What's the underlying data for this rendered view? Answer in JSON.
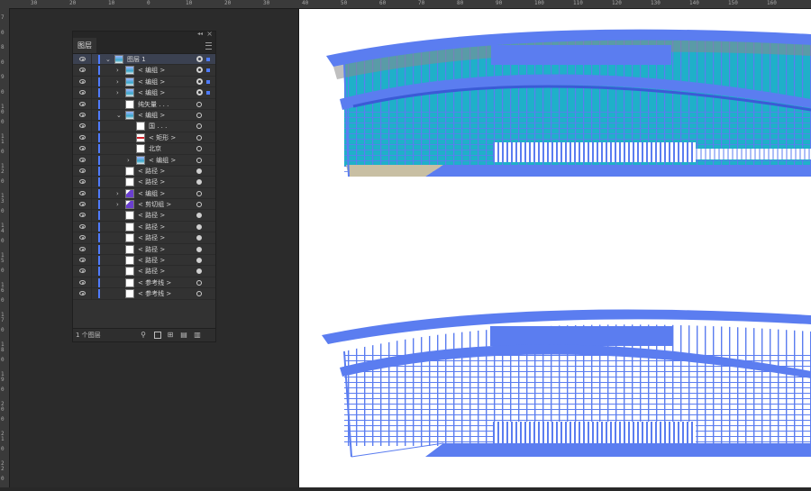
{
  "ruler": {
    "top_labels": [
      "30",
      "20",
      "10",
      "0",
      "10",
      "20",
      "30",
      "40",
      "50",
      "60",
      "70",
      "80",
      "90",
      "100",
      "110",
      "120",
      "130",
      "140",
      "150",
      "160"
    ],
    "left_labels": [
      "7",
      "0",
      "8",
      "0",
      "9",
      "0",
      "10",
      "0",
      "11",
      "0",
      "12",
      "0",
      "13",
      "0",
      "14",
      "0",
      "15",
      "0",
      "16",
      "0",
      "17",
      "0",
      "18",
      "0",
      "19",
      "0",
      "20",
      "0",
      "21",
      "0",
      "22",
      "0"
    ]
  },
  "panel": {
    "tab_label": "图层",
    "footer_count": "1 个图层",
    "layers": [
      {
        "label": "图层 1",
        "chev": "v",
        "thumb": "building",
        "target": "ring",
        "sel": "square",
        "top": true,
        "indent": 0
      },
      {
        "label": "< 编组 >",
        "chev": ">",
        "thumb": "building",
        "target": "ring",
        "sel": "square",
        "indent": 1
      },
      {
        "label": "< 编组 >",
        "chev": ">",
        "thumb": "building",
        "target": "ring",
        "sel": "square",
        "indent": 1
      },
      {
        "label": "< 编组 >",
        "chev": ">",
        "thumb": "building",
        "target": "ring",
        "sel": "square",
        "indent": 1
      },
      {
        "label": "纯矢量 . . .",
        "chev": "",
        "thumb": "white",
        "target": "",
        "sel": "",
        "indent": 1
      },
      {
        "label": "< 编组 >",
        "chev": "v",
        "thumb": "building",
        "target": "",
        "sel": "",
        "indent": 1
      },
      {
        "label": "国 . . .",
        "chev": "",
        "thumb": "white",
        "target": "",
        "sel": "",
        "indent": 2
      },
      {
        "label": "< 矩形 >",
        "chev": "",
        "thumb": "rect",
        "target": "",
        "sel": "",
        "indent": 2
      },
      {
        "label": "北京",
        "chev": "",
        "thumb": "white",
        "target": "",
        "sel": "",
        "indent": 2
      },
      {
        "label": "< 编组 >",
        "chev": ">",
        "thumb": "building",
        "target": "",
        "sel": "",
        "indent": 2
      },
      {
        "label": "< 路径 >",
        "chev": "",
        "thumb": "white",
        "target": "filled",
        "sel": "",
        "indent": 1
      },
      {
        "label": "< 路径 >",
        "chev": "",
        "thumb": "white",
        "target": "filled",
        "sel": "",
        "indent": 1
      },
      {
        "label": "< 编组 >",
        "chev": ">",
        "thumb": "clip",
        "target": "",
        "sel": "",
        "indent": 1
      },
      {
        "label": "< 剪切组 >",
        "chev": ">",
        "thumb": "clip",
        "target": "",
        "sel": "",
        "indent": 1
      },
      {
        "label": "< 路径 >",
        "chev": "",
        "thumb": "white",
        "target": "filled",
        "sel": "",
        "indent": 1
      },
      {
        "label": "< 路径 >",
        "chev": "",
        "thumb": "white",
        "target": "filled",
        "sel": "",
        "indent": 1
      },
      {
        "label": "< 路径 >",
        "chev": "",
        "thumb": "white",
        "target": "filled",
        "sel": "",
        "indent": 1
      },
      {
        "label": "< 路径 >",
        "chev": "",
        "thumb": "white",
        "target": "filled",
        "sel": "",
        "indent": 1
      },
      {
        "label": "< 路径 >",
        "chev": "",
        "thumb": "white",
        "target": "filled",
        "sel": "",
        "indent": 1
      },
      {
        "label": "< 路径 >",
        "chev": "",
        "thumb": "white",
        "target": "filled",
        "sel": "",
        "indent": 1
      },
      {
        "label": "< 参考线 >",
        "chev": "",
        "thumb": "white",
        "target": "",
        "sel": "",
        "indent": 1
      },
      {
        "label": "< 参考线 >",
        "chev": "",
        "thumb": "white",
        "target": "",
        "sel": "",
        "indent": 1
      }
    ]
  },
  "colors": {
    "selection_blue": "#4f7cff",
    "building_cyan": "#1fb0c9",
    "building_sand": "#c8bfa3"
  }
}
